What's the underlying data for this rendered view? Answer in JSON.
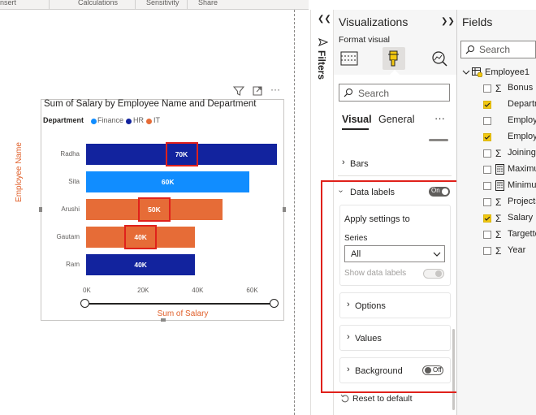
{
  "ribbon": {
    "items": [
      "nsert",
      "Calculations",
      "Sensitivity",
      "Share"
    ]
  },
  "chart_data": {
    "type": "bar",
    "orientation": "horizontal",
    "title": "Sum of Salary by Employee Name and Department",
    "xlabel": "Sum of Salary",
    "ylabel": "Employee Name",
    "legend_title": "Department",
    "legend": [
      {
        "name": "Finance",
        "color": "#118dff"
      },
      {
        "name": "HR",
        "color": "#12239e"
      },
      {
        "name": "IT",
        "color": "#e66c37"
      }
    ],
    "categories": [
      "Radha",
      "Sita",
      "Arushi",
      "Gautam",
      "Ram"
    ],
    "departments": [
      "HR",
      "Finance",
      "IT",
      "IT",
      "HR"
    ],
    "values": [
      70000,
      60000,
      50000,
      40000,
      40000
    ],
    "data_labels": [
      "70K",
      "60K",
      "50K",
      "40K",
      "40K"
    ],
    "xlim": [
      0,
      70000
    ],
    "xticks": [
      "0K",
      "20K",
      "40K",
      "60K"
    ],
    "tick_values": [
      0,
      20000,
      40000,
      60000
    ],
    "highlighted": [
      "Radha",
      "Arushi",
      "Gautam"
    ]
  },
  "visual_header": {
    "filter_icon": "filter-icon",
    "focus_icon": "focus-mode-icon",
    "more_label": "···"
  },
  "filters": {
    "label": "Filters",
    "collapse_glyph": "❮❮"
  },
  "viz_pane": {
    "title": "Visualizations",
    "expand_glyph": "❯❯",
    "subtitle": "Format visual",
    "search_placeholder": "Search",
    "tabs": [
      "Visual",
      "General"
    ],
    "more_label": "···",
    "sections": {
      "bars": "Bars",
      "data_labels": "Data labels",
      "data_labels_state": "On",
      "apply_settings": "Apply settings to",
      "series_label": "Series",
      "series_value": "All",
      "show_data_labels": "Show data labels",
      "options": "Options",
      "values": "Values",
      "background": "Background",
      "background_state": "Off",
      "reset": "Reset to default"
    }
  },
  "fields_pane": {
    "title": "Fields",
    "search_placeholder": "Search",
    "table": "Employee1",
    "items": [
      {
        "label": "Bonus",
        "kind": "sigma",
        "checked": false
      },
      {
        "label": "Departm",
        "kind": "text",
        "checked": true
      },
      {
        "label": "Employ",
        "kind": "text",
        "checked": false
      },
      {
        "label": "Employe",
        "kind": "text",
        "checked": true
      },
      {
        "label": "Joining",
        "kind": "sigma",
        "checked": false
      },
      {
        "label": "Maximu",
        "kind": "calc",
        "checked": false
      },
      {
        "label": "Minimu",
        "kind": "calc",
        "checked": false
      },
      {
        "label": "Projects",
        "kind": "sigma",
        "checked": false
      },
      {
        "label": "Salary",
        "kind": "sigma",
        "checked": true
      },
      {
        "label": "Targette",
        "kind": "sigma",
        "checked": false
      },
      {
        "label": "Year",
        "kind": "sigma",
        "checked": false
      }
    ]
  }
}
